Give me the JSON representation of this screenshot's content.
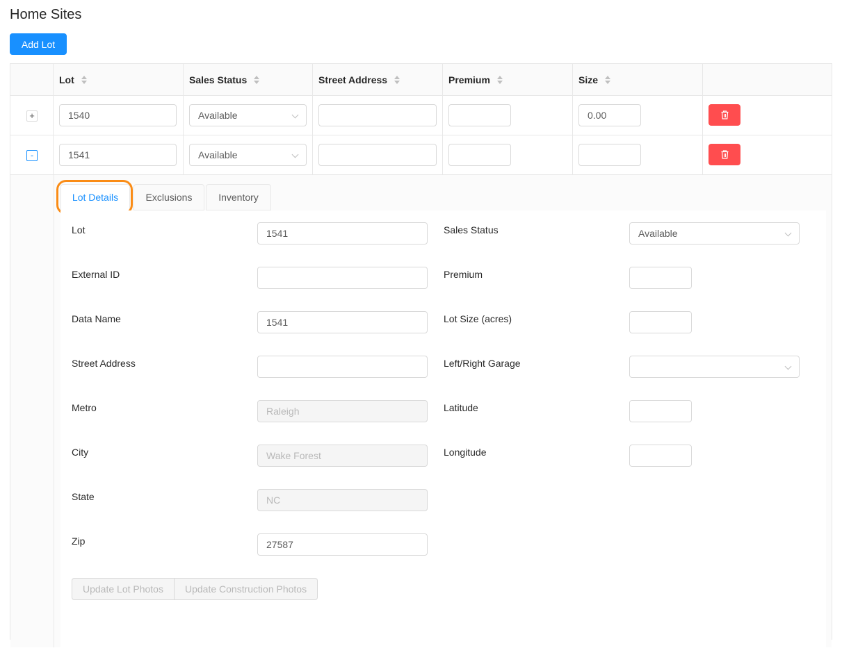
{
  "page": {
    "title": "Home Sites",
    "add_button": "Add Lot"
  },
  "table": {
    "columns": [
      "Lot",
      "Sales Status",
      "Street Address",
      "Premium",
      "Size",
      ""
    ],
    "rows": [
      {
        "expand": "+",
        "lot": "1540",
        "status": "Available",
        "street": "",
        "premium": "",
        "size": "0.00"
      },
      {
        "expand": "-",
        "lot": "1541",
        "status": "Available",
        "street": "",
        "premium": "",
        "size": ""
      }
    ]
  },
  "tabs": [
    "Lot Details",
    "Exclusions",
    "Inventory"
  ],
  "details": {
    "left": [
      {
        "label": "Lot",
        "value": "1541",
        "disabled": false
      },
      {
        "label": "External ID",
        "value": "",
        "disabled": false
      },
      {
        "label": "Data Name",
        "value": "1541",
        "disabled": false
      },
      {
        "label": "Street Address",
        "value": "",
        "disabled": false
      },
      {
        "label": "Metro",
        "value": "Raleigh",
        "disabled": true
      },
      {
        "label": "City",
        "value": "Wake Forest",
        "disabled": true
      },
      {
        "label": "State",
        "value": "NC",
        "disabled": true
      },
      {
        "label": "Zip",
        "value": "27587",
        "disabled": false
      }
    ],
    "right": [
      {
        "label": "Sales Status",
        "value": "Available",
        "type": "select"
      },
      {
        "label": "Premium",
        "value": "",
        "type": "input"
      },
      {
        "label": "Lot Size (acres)",
        "value": "",
        "type": "input"
      },
      {
        "label": "Left/Right Garage",
        "value": "",
        "type": "select"
      },
      {
        "label": "Latitude",
        "value": "",
        "type": "input"
      },
      {
        "label": "Longitude",
        "value": "",
        "type": "input"
      }
    ],
    "buttons": {
      "lot_photos": "Update Lot Photos",
      "construction_photos": "Update Construction Photos"
    }
  },
  "colors": {
    "primary": "#1890ff",
    "danger": "#ff4d4f",
    "highlight": "#fa8c16"
  },
  "icons": {
    "delete": "trash-icon",
    "sort": "sort-icon"
  }
}
